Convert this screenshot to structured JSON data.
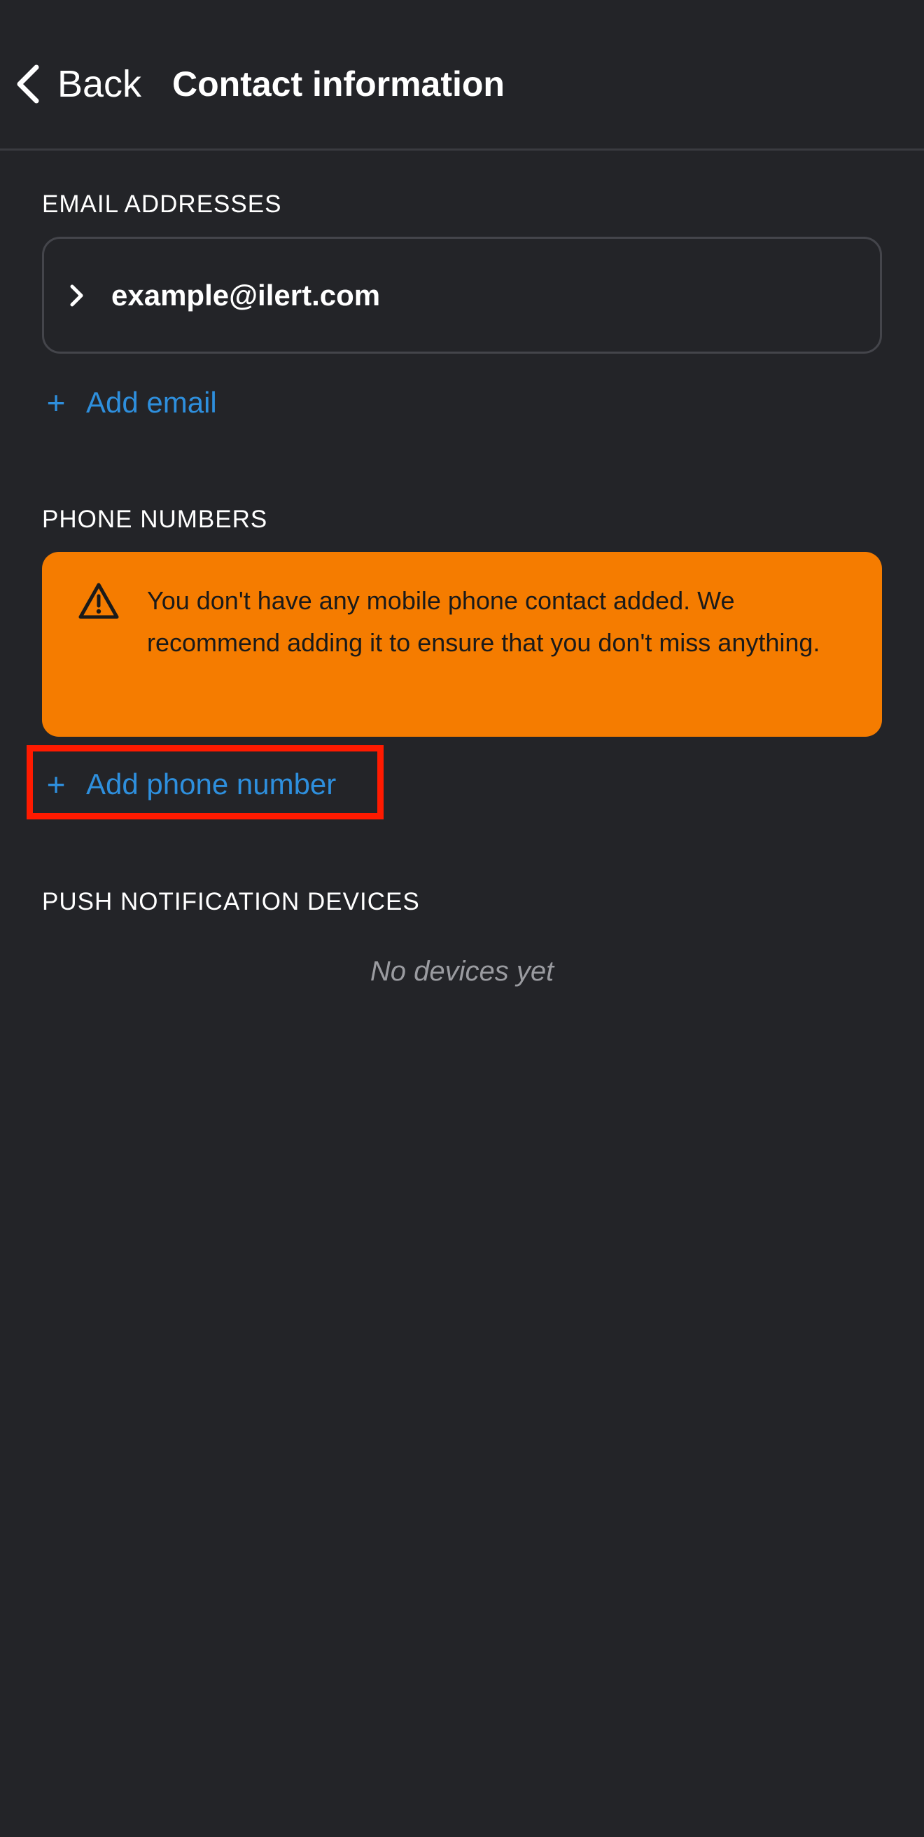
{
  "header": {
    "back_label": "Back",
    "title": "Contact information"
  },
  "email_section": {
    "heading": "EMAIL ADDRESSES",
    "items": [
      {
        "value": "example@ilert.com"
      }
    ],
    "add_label": "Add email",
    "add_icon": "+"
  },
  "phone_section": {
    "heading": "PHONE NUMBERS",
    "warning_icon": "warning-triangle-icon",
    "warning_text": "You don't have any mobile phone contact added. We recommend adding it to ensure that you don't miss anything.",
    "warning_color": "#f57c00",
    "add_label": "Add phone number",
    "add_icon": "+",
    "highlight_color": "#ff1a00"
  },
  "push_section": {
    "heading": "PUSH NOTIFICATION DEVICES",
    "empty_text": "No devices yet"
  },
  "colors": {
    "background": "#232428",
    "accent": "#2e8fdd",
    "muted": "#9a9ba0"
  }
}
